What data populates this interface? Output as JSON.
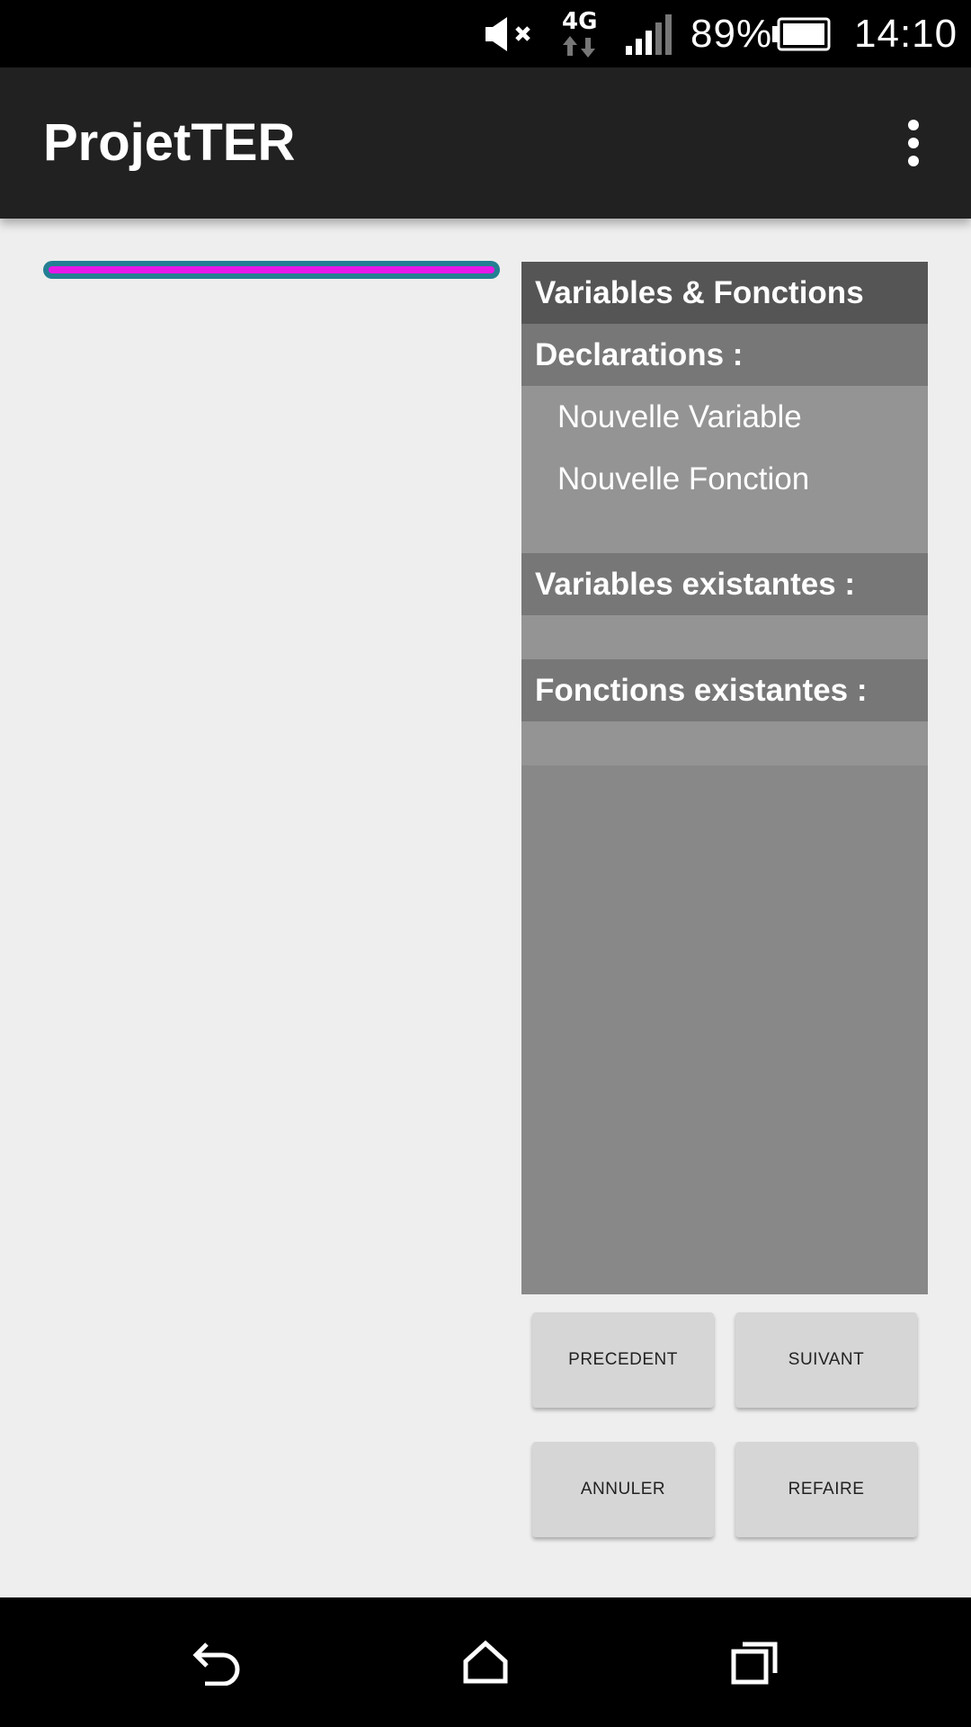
{
  "status_bar": {
    "battery_percent": "89%",
    "time": "14:10",
    "network": "4G",
    "icons": [
      "mute-icon",
      "network-4g-icon",
      "signal-icon",
      "battery-icon"
    ]
  },
  "app_bar": {
    "title": "ProjetTER",
    "menu_icon": "overflow-menu-icon"
  },
  "slider": {
    "value_percent": 100,
    "track_color": "#247f93",
    "fill_color": "#e818e8"
  },
  "panel": {
    "title": "Variables & Fonctions",
    "declarations_header": "Declarations :",
    "declarations_items": [
      "Nouvelle Variable",
      "Nouvelle Fonction"
    ],
    "variables_header": "Variables existantes :",
    "functions_header": "Fonctions existantes :"
  },
  "buttons": {
    "previous": "PRECEDENT",
    "next": "SUIVANT",
    "undo": "ANNULER",
    "redo": "REFAIRE"
  },
  "nav_bar": {
    "icons": [
      "back-icon",
      "home-icon",
      "recents-icon"
    ]
  }
}
